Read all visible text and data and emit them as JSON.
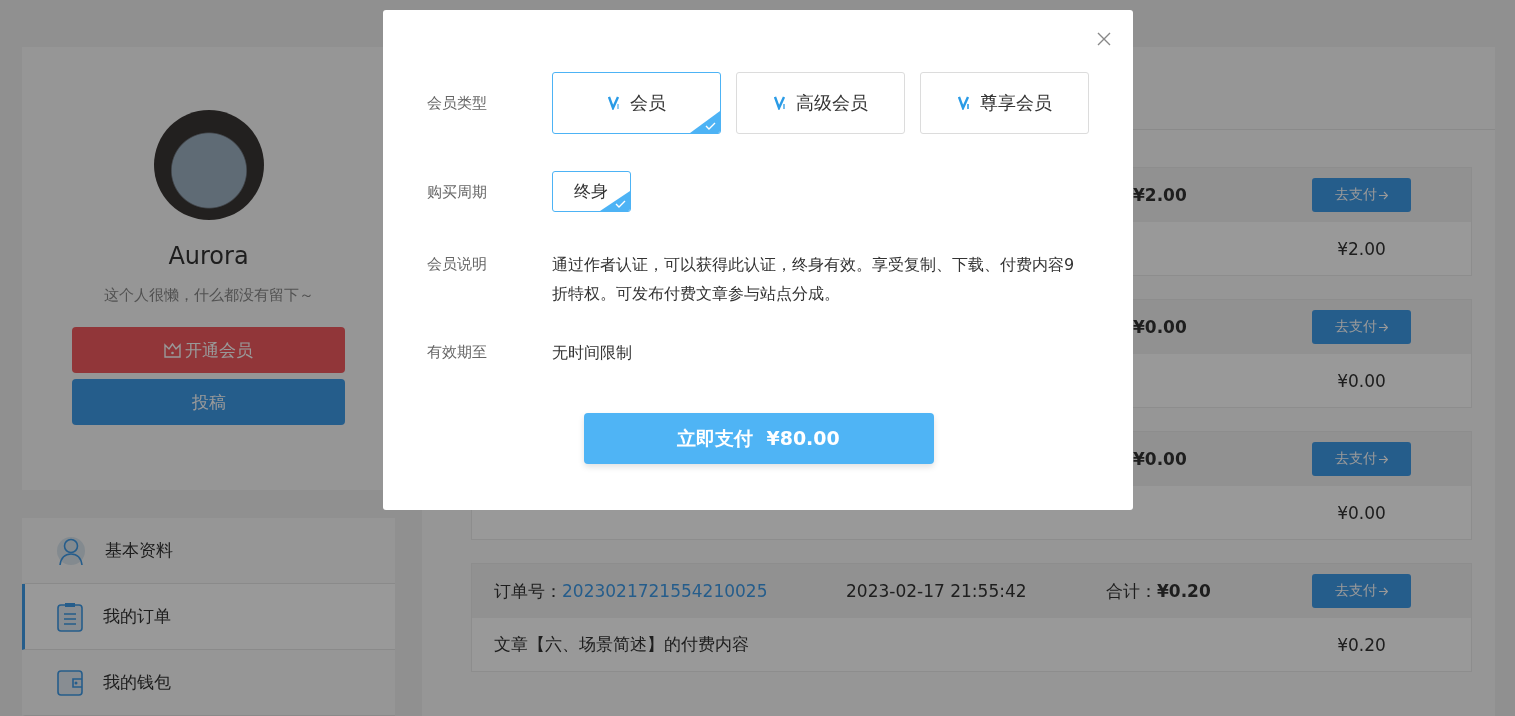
{
  "profile": {
    "name": "Aurora",
    "bio": "这个人很懒，什么都没有留下～",
    "buttons": [
      {
        "kind": "vip",
        "label": "开通会员"
      },
      {
        "kind": "post",
        "label": "投稿"
      }
    ]
  },
  "nav": [
    {
      "kind": "profile",
      "label": "基本资料",
      "selected": false
    },
    {
      "kind": "orders",
      "label": "我的订单",
      "selected": true
    },
    {
      "kind": "wallet",
      "label": "我的钱包",
      "selected": false
    }
  ],
  "orders": [
    {
      "total": "¥2.00",
      "pay_button": "去支付",
      "amount": "¥2.00"
    },
    {
      "total": "¥0.00",
      "pay_button": "去支付",
      "amount": "¥0.00"
    },
    {
      "total": "¥0.00",
      "pay_button": "去支付",
      "amount": "¥0.00"
    },
    {
      "number_label": "订单号：",
      "number": "2023021721554210025",
      "date": "2023-02-17 21:55:42",
      "total_label": "合计：",
      "total": "¥0.20",
      "pay_button": "去支付",
      "description": "文章【六、场景简述】的付费内容",
      "amount": "¥0.20"
    }
  ],
  "dialog": {
    "type_label": "会员类型",
    "types": [
      {
        "label": "会员",
        "selected": true
      },
      {
        "label": "高级会员",
        "selected": false
      },
      {
        "label": "尊享会员",
        "selected": false
      }
    ],
    "period_label": "购买周期",
    "periods": [
      {
        "label": "终身",
        "selected": true
      }
    ],
    "description_label": "会员说明",
    "description": "通过作者认证，可以获得此认证，终身有效。享受复制、下载、付费内容9折特权。可发布付费文章参与站点分成。",
    "expiry_label": "有效期至",
    "expiry": "无时间限制",
    "pay_button": "立即支付  ¥80.00"
  }
}
